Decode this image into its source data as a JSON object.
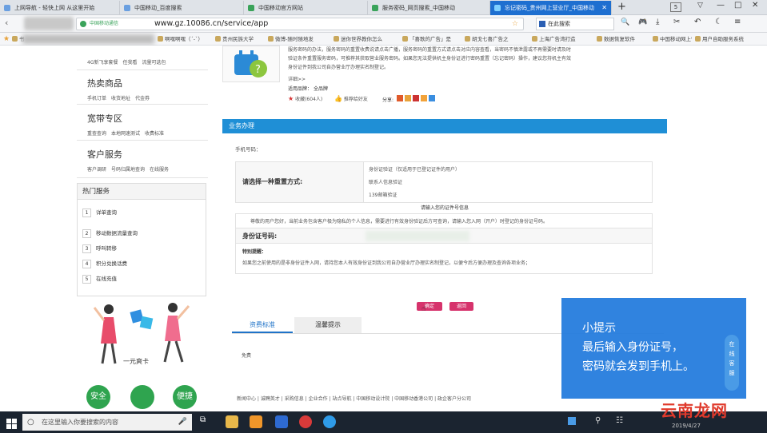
{
  "browser": {
    "tabs": [
      {
        "label": "上网导航 - 轻快上网 从这里开始",
        "active": false
      },
      {
        "label": "中国移动_百度搜索",
        "active": false
      },
      {
        "label": "中国移动官方网站",
        "active": false
      },
      {
        "label": "服务密码_网页搜索_中国移动",
        "active": false
      },
      {
        "label": "忘记密码_贵州网上营业厅_中国移动",
        "active": true
      }
    ],
    "new_tab": "+",
    "tab_count": "5",
    "url_prefix": "中国移动通信",
    "url": "www.gz.10086.cn/service/app",
    "search_placeholder": "在此搜索",
    "bookmarks": [
      "书",
      "啊嘿啊嘿（´-`）",
      "贵州民族大学",
      "微博-随时随地发",
      "迷你世界教你怎么",
      "「喜歌的广告」是",
      "胡戈七喜广告之",
      "上海广告湾打造",
      "数据恢复软件",
      "中国移动网上营业",
      "用户自助服务系统"
    ]
  },
  "left": {
    "top_links": [
      "4G新飞享套餐",
      "任我看",
      "流量可选包"
    ],
    "sections": [
      {
        "title": "热卖商品",
        "links": [
          "手机订单",
          "收货地址",
          "代金券"
        ]
      },
      {
        "title": "宽带专区",
        "links": [
          "重查查询",
          "本地网速测试",
          "收费标准"
        ]
      },
      {
        "title": "客户服务",
        "links": [
          "客户调研",
          "号码归属地查询",
          "在线服务"
        ]
      }
    ],
    "hot_title": "热门服务",
    "hot_items": [
      {
        "num": "1",
        "label": "详单查询"
      },
      {
        "num": "2",
        "label": "移动数据流量查询"
      },
      {
        "num": "3",
        "label": "呼叫转移"
      },
      {
        "num": "4",
        "label": "积分兑换话费"
      },
      {
        "num": "5",
        "label": "在线充值"
      }
    ],
    "promo_caption": "一元爽卡",
    "badge_left": "安全",
    "badge_right": "便捷"
  },
  "main": {
    "desc_line1": "服务密码的办法，服务密码的重置收费说请点击广播，服务密码的重置方式请点击对应内容查看，当密码不慎泄露或不再需要时请及时",
    "desc_line2": "验证条件重置服务密码，可推荐其获取营业服务密码。如果您无法提供机主身份证进行密码重置（忘记密码）操作，建议您持机主有效",
    "desc_line3": "身份证件到我公司自办营业厅办理实名制登记。",
    "detail_link": "详细>>",
    "brand_label": "适用品牌：",
    "brand_value": "全品牌",
    "fav_text": "收藏(604人)",
    "recommend_text": "推荐给好友",
    "share_label": "分享:",
    "section_title": "业务办理",
    "phone_label": "手机号码：",
    "reset_label": "请选择一种重置方式:",
    "reset_options": [
      "身份证验证（仅适用于已登记证件的用户）",
      "联系人信息验证",
      "139邮箱验证"
    ],
    "id_info_title": "请输入您的证件号信息",
    "id_info_note": "尊敬的用户您好，当前业务包含客户极为隐私的个人信息，需要进行有效身份验证后方可查询，请输入您入网（开户）时登记的身份证号码。",
    "id_label": "身份证号码:",
    "special_title": "特别提醒：",
    "special_text": "如果您之前使用的是非身份证件入网，请持您本人有效身份证到我公司自办营业厅办理实名制登记，以便今后方便办理及查询各项业务；",
    "confirm_label": "确定",
    "back_label": "返回",
    "tab_fee": "资费标准",
    "tab_tip": "温馨提示",
    "fee_value": "免费",
    "footer_links": [
      "新闻中心",
      "诚聘英才",
      "采购信息",
      "企业合作",
      "站点导航",
      "中国移动设计院",
      "中国移动香港公司",
      "政企客户分公司"
    ]
  },
  "tip": {
    "title": "小提示",
    "line1": "最后输入身份证号，",
    "line2": "密码就会发到手机上。"
  },
  "side_float": [
    "在",
    "线",
    "客",
    "服"
  ],
  "taskbar": {
    "search_placeholder": "在这里输入你要搜索的内容",
    "date": "2019/4/27"
  },
  "watermark": "云南龙网"
}
